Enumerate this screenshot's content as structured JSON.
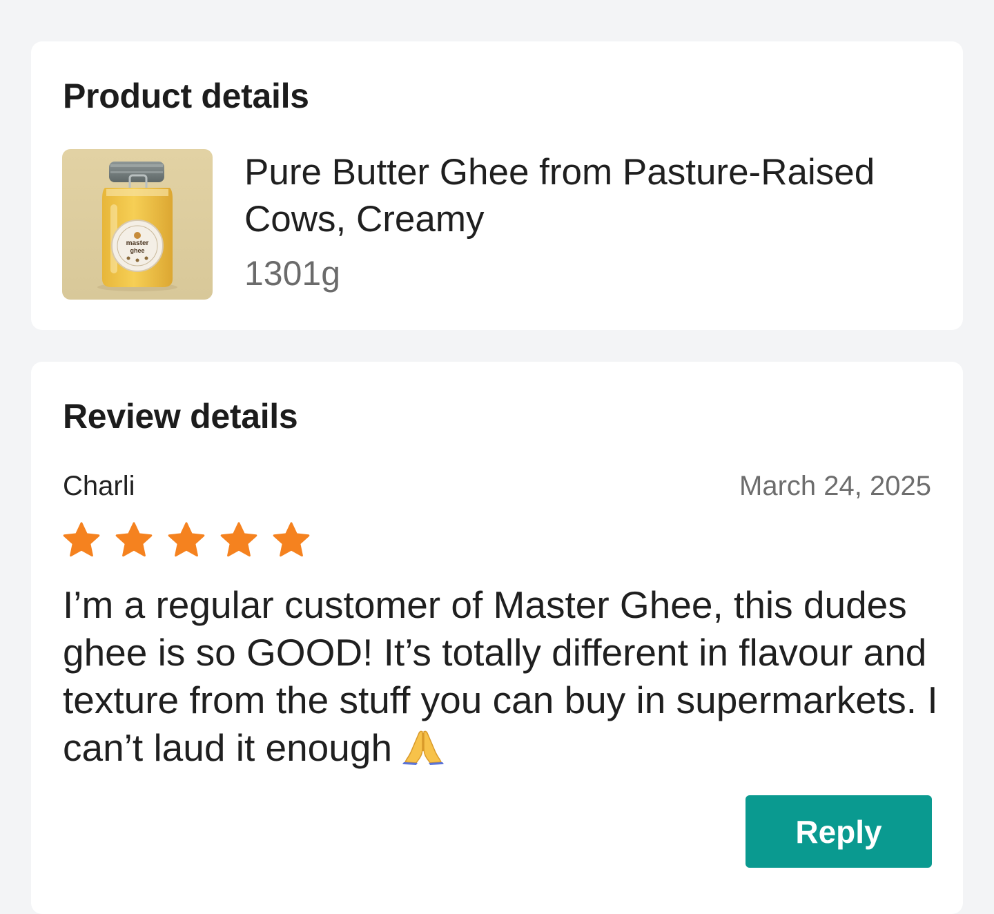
{
  "product_section": {
    "title": "Product details",
    "product_name": "Pure Butter Ghee from Pasture-Raised Cows, Creamy",
    "product_weight": "1301g",
    "image_icon": "ghee-jar-image",
    "image_label_text": "master ghee"
  },
  "review_section": {
    "title": "Review details",
    "reviewer_name": "Charli",
    "review_date": "March 24, 2025",
    "rating": 5,
    "rating_max": 5,
    "star_color": "#f5821f",
    "review_text": "I’m a regular customer of Master Ghee, this dudes ghee is so GOOD! It’s totally different in flavour and texture from the stuff you can buy in supermarkets. I can’t laud it enough",
    "review_emoji": "folded-hands-emoji",
    "reply_label": "Reply"
  },
  "colors": {
    "background": "#f3f4f6",
    "card": "#ffffff",
    "accent": "#0a9a90",
    "text_secondary": "#6d6d6d"
  }
}
